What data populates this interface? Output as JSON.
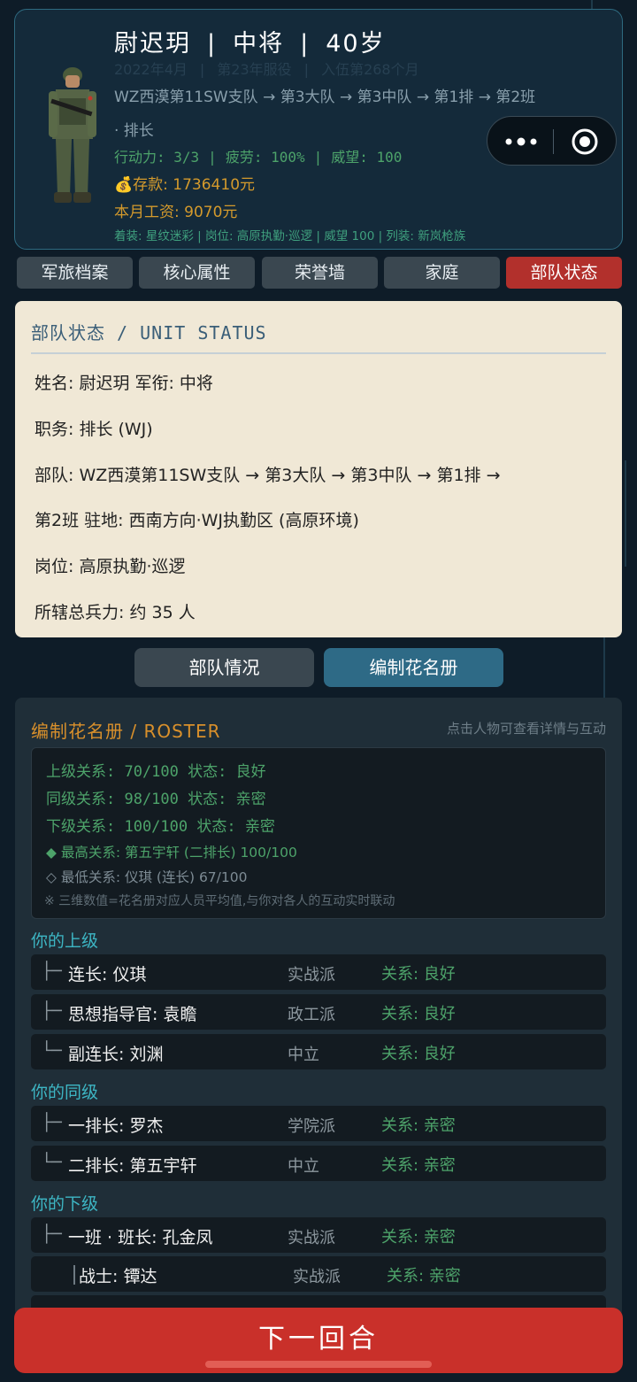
{
  "header": {
    "name": "尉迟玥",
    "rank": "中将",
    "age": "40岁",
    "faded_date": "2022年4月",
    "faded_service": "第23年服役",
    "faded_months": "入伍第268个月",
    "unit_path": "WZ西漠第11SW支队 → 第3大队 → 第3中队 → 第1排 → 第2班",
    "role": "· 排长",
    "action": "行动力: 3/3",
    "fatigue": "疲劳: 100%",
    "prestige": "威望: 100",
    "savings": "💰存款: 1736410元",
    "salary": "本月工资: 9070元",
    "equipment": "着装: 星纹迷彩 | 岗位: 高原执勤·巡逻 | 威望 100 | 列装: 新岚枪族"
  },
  "tabs": [
    {
      "label": "军旅档案"
    },
    {
      "label": "核心属性"
    },
    {
      "label": "荣誉墙"
    },
    {
      "label": "家庭"
    },
    {
      "label": "部队状态"
    }
  ],
  "status": {
    "title": "部队状态 / UNIT STATUS",
    "line1": "姓名: 尉迟玥  军衔: 中将",
    "line2": "职务: 排长 (WJ)",
    "line3": "部队: WZ西漠第11SW支队 → 第3大队 → 第3中队 → 第1排 →",
    "line4": "第2班  驻地: 西南方向·WJ执勤区 (高原环境)",
    "line5": "岗位: 高原执勤·巡逻",
    "line6": "所辖总兵力: 约 35 人"
  },
  "subtabs": {
    "unit": "部队情况",
    "roster": "编制花名册"
  },
  "roster": {
    "title": "编制花名册 / ROSTER",
    "hint": "点击人物可查看详情与互动",
    "superior_rel": "上级关系: 70/100  状态: 良好",
    "peer_rel": "同级关系: 98/100  状态: 亲密",
    "sub_rel": "下级关系: 100/100  状态: 亲密",
    "highest": "◆ 最高关系: 第五宇轩 (二排长) 100/100",
    "lowest": "◇ 最低关系: 仪琪 (连长) 67/100",
    "note": "※ 三维数值=花名册对应人员平均值,与你对各人的互动实时联动",
    "sec_superiors": "你的上级",
    "sec_peers": "你的同级",
    "sec_subordinates": "你的下级",
    "superiors": [
      {
        "tree": "├─",
        "name": "连长: 仪琪",
        "faction": "实战派",
        "relation": "关系: 良好"
      },
      {
        "tree": "├─",
        "name": "思想指导官: 袁瞻",
        "faction": "政工派",
        "relation": "关系: 良好"
      },
      {
        "tree": "└─",
        "name": "副连长: 刘渊",
        "faction": "中立",
        "relation": "关系: 良好"
      }
    ],
    "peers": [
      {
        "tree": "├─",
        "name": "一排长: 罗杰",
        "faction": "学院派",
        "relation": "关系: 亲密"
      },
      {
        "tree": "└─",
        "name": "二排长: 第五宇轩",
        "faction": "中立",
        "relation": "关系: 亲密"
      }
    ],
    "subordinates": [
      {
        "tree": "├─",
        "name": "一班 · 班长: 孔金凤",
        "faction": "实战派",
        "relation": "关系: 亲密"
      },
      {
        "tree": "",
        "name": "战士: 镡达",
        "faction": "实战派",
        "relation": "关系: 亲密"
      }
    ]
  },
  "next_button": "下一回合",
  "colors": {
    "background": "#0e1c28",
    "active_tab": "#b2302c",
    "next_button": "#c9302a",
    "relation_green": "#4da36a",
    "gold": "#d49a2c",
    "section_cyan": "#3db6c4"
  },
  "icons": [
    "soldier-avatar",
    "more-dots-icon",
    "target-close-icon",
    "money-bag-icon"
  ]
}
